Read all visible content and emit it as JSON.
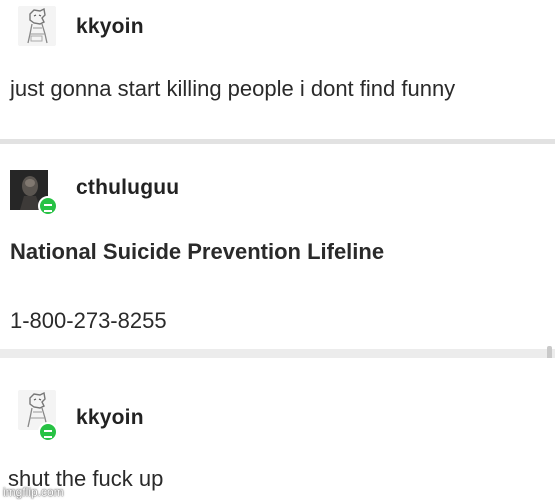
{
  "posts": [
    {
      "username": "kkyoin",
      "body": "just gonna start killing people i dont find funny"
    },
    {
      "username": "cthuluguu",
      "title": "National Suicide Prevention Lifeline",
      "phone": "1-800-273-8255"
    },
    {
      "username": "kkyoin",
      "body": "shut the fuck up"
    }
  ],
  "watermark": "imgflip.com",
  "colors": {
    "badge": "#27c244",
    "separator": "#d8d8d8"
  }
}
